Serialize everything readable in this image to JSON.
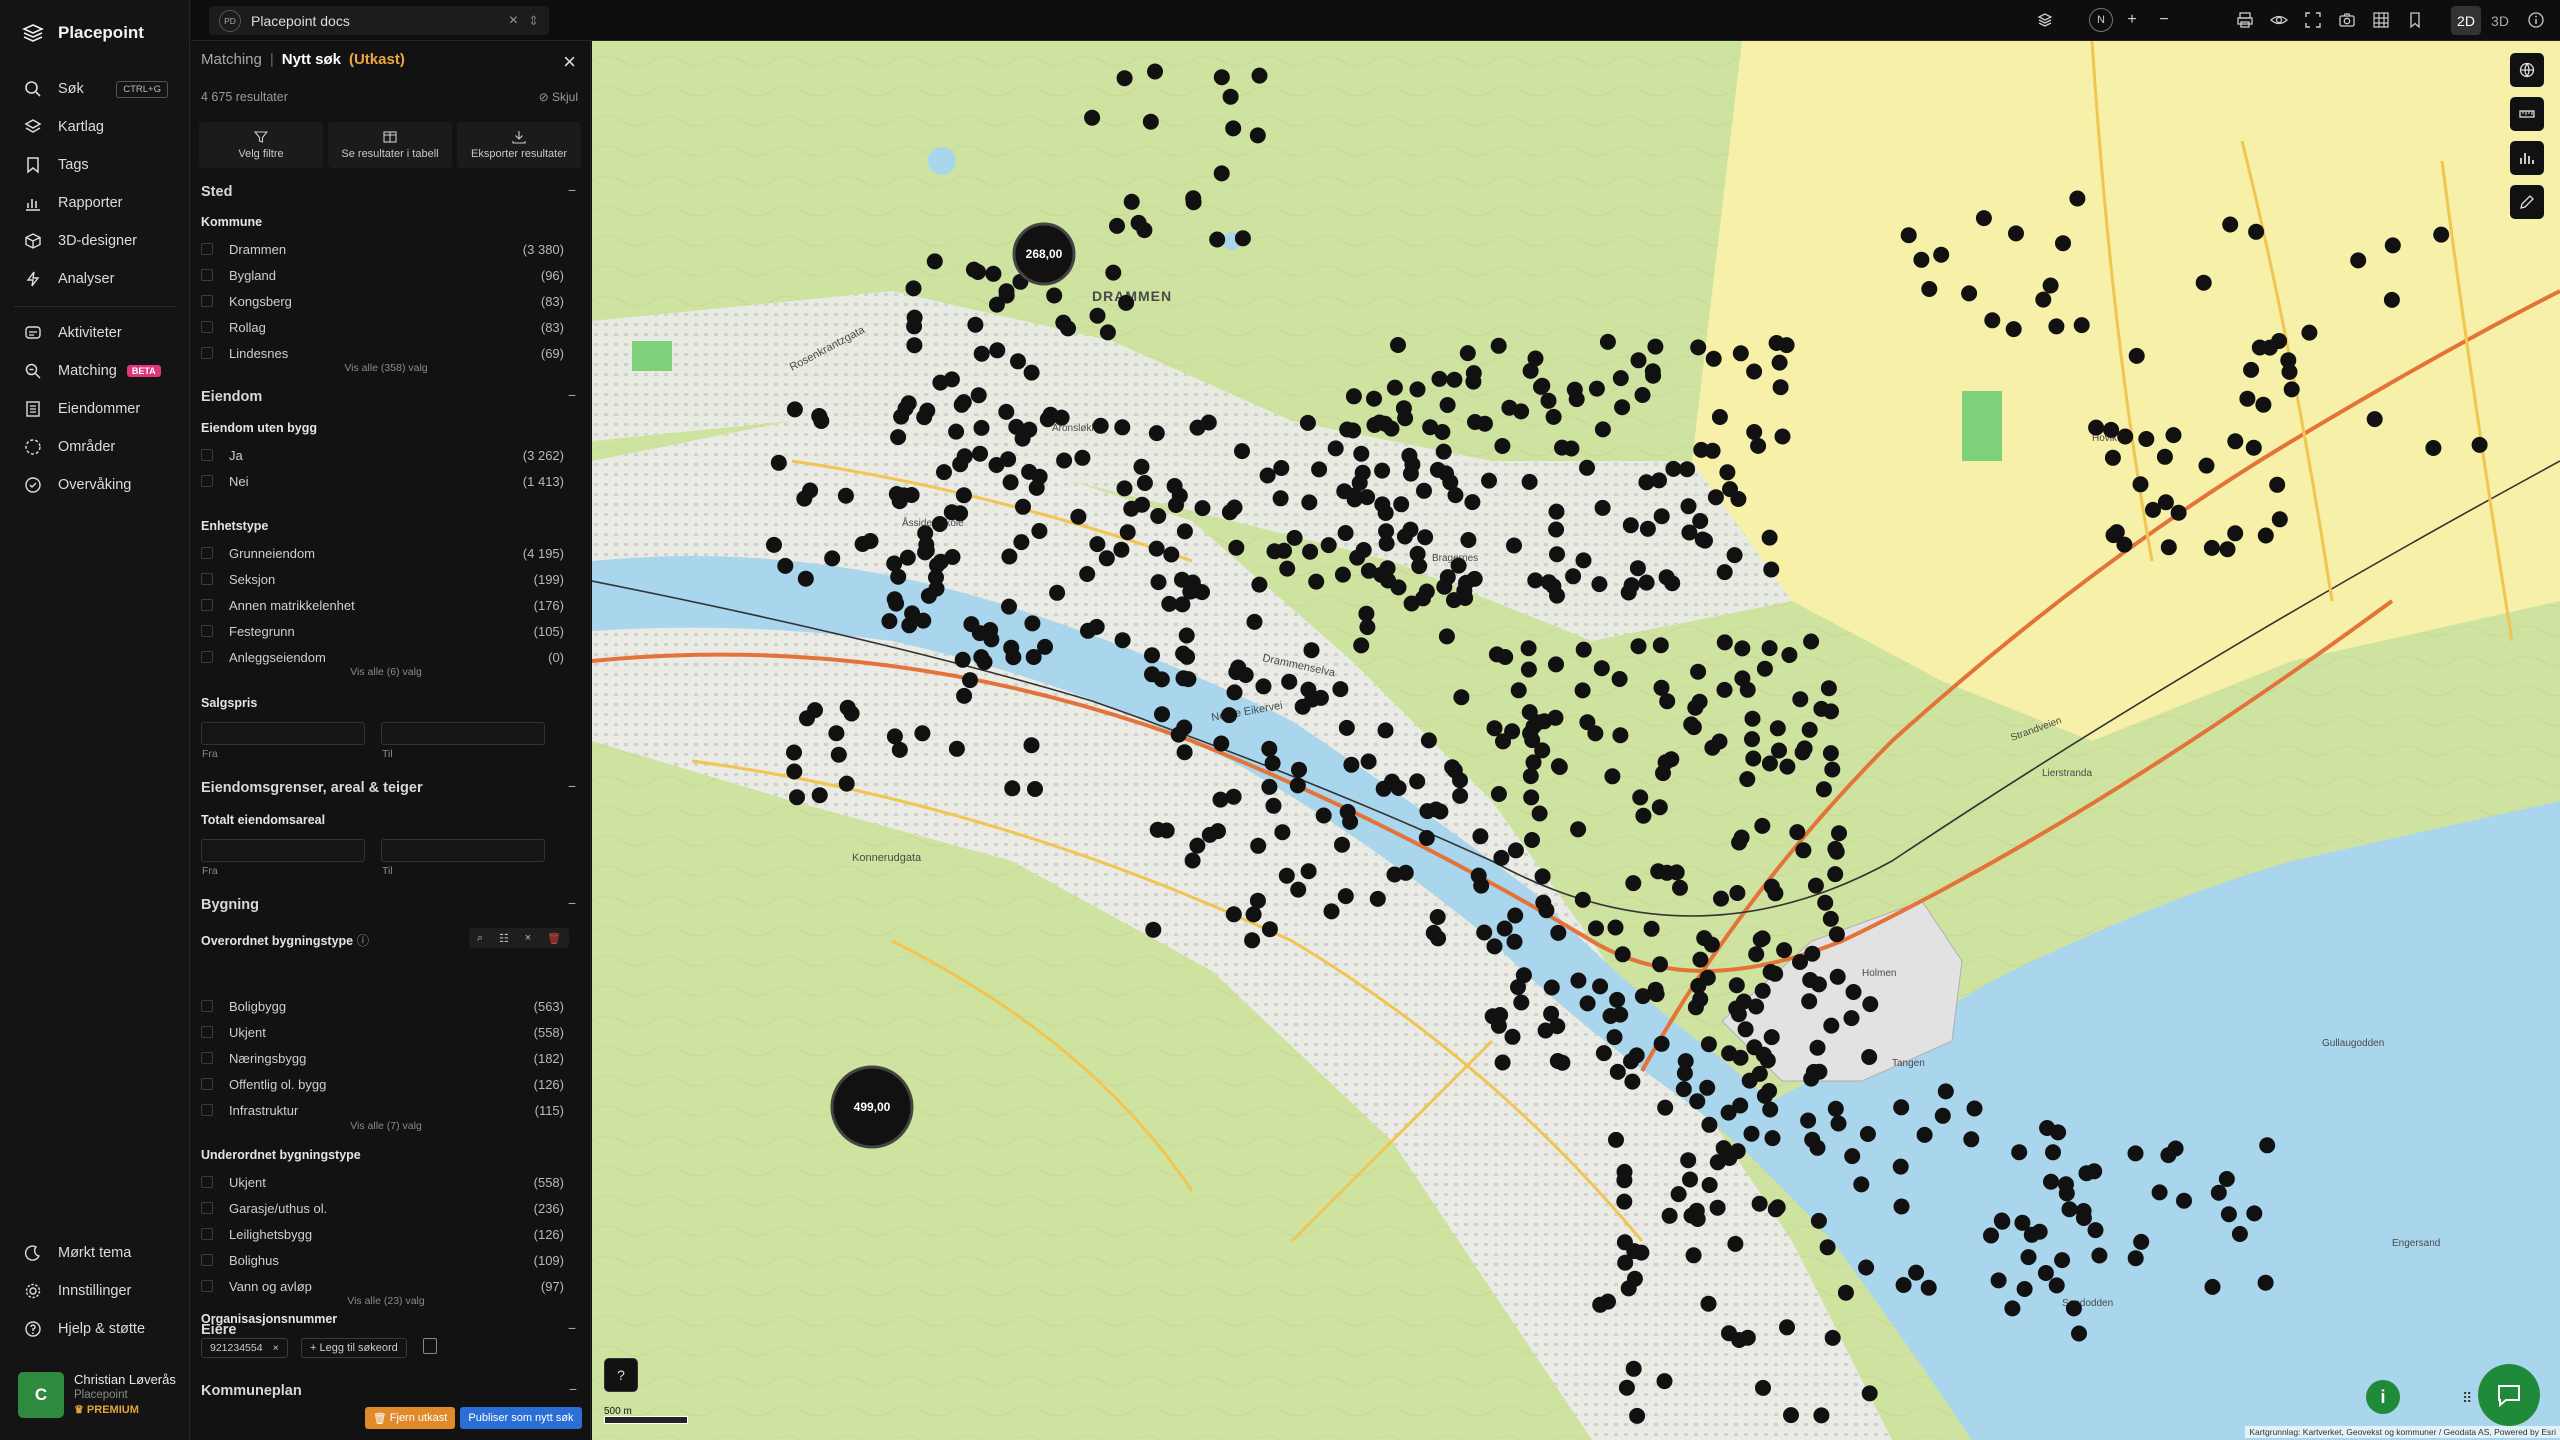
{
  "app": {
    "name": "Placepoint"
  },
  "nav": {
    "items": [
      {
        "label": "Søk",
        "shortcut": "CTRL+G",
        "icon": "search-icon"
      },
      {
        "label": "Kartlag",
        "icon": "layers-icon"
      },
      {
        "label": "Tags",
        "icon": "bookmark-icon"
      },
      {
        "label": "Rapporter",
        "icon": "chart-icon"
      },
      {
        "label": "3D-designer",
        "icon": "cube-icon"
      },
      {
        "label": "Analyser",
        "icon": "bolt-icon"
      },
      {
        "label": "Aktiviteter",
        "icon": "activity-icon"
      },
      {
        "label": "Matching",
        "badge": "BETA",
        "icon": "match-icon"
      },
      {
        "label": "Eiendommer",
        "icon": "building-icon"
      },
      {
        "label": "Områder",
        "icon": "area-icon"
      },
      {
        "label": "Overvåking",
        "icon": "monitor-icon"
      }
    ],
    "bottom": [
      {
        "label": "Mørkt tema",
        "icon": "moon-icon"
      },
      {
        "label": "Innstillinger",
        "icon": "gear-icon"
      },
      {
        "label": "Hjelp & støtte",
        "icon": "help-icon"
      }
    ],
    "user": {
      "initial": "C",
      "name": "Christian Løverås",
      "org": "Placepoint",
      "plan": "PREMIUM"
    }
  },
  "topbar": {
    "doc_badge": "PD",
    "doc_title": "Placepoint docs",
    "dim_2d": "2D",
    "dim_3d": "3D",
    "compass": "N"
  },
  "panel": {
    "crumb": "Matching",
    "separator": "|",
    "title": "Nytt søk",
    "status": "(Utkast)",
    "results": "4 675 resultater",
    "hide": "Skjul",
    "actions": [
      "Velg filtre",
      "Se resultater i tabell",
      "Eksporter resultater"
    ],
    "sted": {
      "title": "Sted",
      "kommune_label": "Kommune",
      "rows": [
        {
          "name": "Drammen",
          "count": "(3 380)"
        },
        {
          "name": "Bygland",
          "count": "(96)"
        },
        {
          "name": "Kongsberg",
          "count": "(83)"
        },
        {
          "name": "Rollag",
          "count": "(83)"
        },
        {
          "name": "Lindesnes",
          "count": "(69)"
        }
      ],
      "more": "Vis alle (358) valg"
    },
    "eiendom": {
      "title": "Eiendom",
      "uten_bygg_label": "Eiendom uten bygg",
      "uten_bygg": [
        {
          "name": "Ja",
          "count": "(3 262)"
        },
        {
          "name": "Nei",
          "count": "(1 413)"
        }
      ],
      "enhetstype_label": "Enhetstype",
      "enhetstype": [
        {
          "name": "Grunneiendom",
          "count": "(4 195)"
        },
        {
          "name": "Seksjon",
          "count": "(199)"
        },
        {
          "name": "Annen matrikkelenhet",
          "count": "(176)"
        },
        {
          "name": "Festegrunn",
          "count": "(105)"
        },
        {
          "name": "Anleggseiendom",
          "count": "(0)"
        }
      ],
      "enhetstype_more": "Vis alle (6) valg",
      "salgspris_label": "Salgspris",
      "from": "Fra",
      "to": "Til"
    },
    "grenser": {
      "title": "Eiendomsgrenser, areal & teiger",
      "areal_label": "Totalt eiendomsareal",
      "from": "Fra",
      "to": "Til"
    },
    "bygning": {
      "title": "Bygning",
      "overordnet_label": "Overordnet bygningstype",
      "overordnet": [
        {
          "name": "Boligbygg",
          "count": "(563)"
        },
        {
          "name": "Ukjent",
          "count": "(558)"
        },
        {
          "name": "Næringsbygg",
          "count": "(182)"
        },
        {
          "name": "Offentlig ol. bygg",
          "count": "(126)"
        },
        {
          "name": "Infrastruktur",
          "count": "(115)"
        }
      ],
      "overordnet_more": "Vis alle (7) valg",
      "underordnet_label": "Underordnet bygningstype",
      "underordnet": [
        {
          "name": "Ukjent",
          "count": "(558)"
        },
        {
          "name": "Garasje/uthus ol.",
          "count": "(236)"
        },
        {
          "name": "Leilighetsbygg",
          "count": "(126)"
        },
        {
          "name": "Bolighus",
          "count": "(109)"
        },
        {
          "name": "Vann og avløp",
          "count": "(97)"
        }
      ],
      "underordnet_more": "Vis alle (23) valg"
    },
    "eiere": {
      "title": "Eiere",
      "org_label": "Organisasjonsnummer",
      "chip": "921234554",
      "add": "Legg til søkeord"
    },
    "kommuneplan": {
      "title": "Kommuneplan"
    },
    "footer": {
      "remove": "Fjern utkast",
      "publish": "Publiser som nytt søk"
    }
  },
  "map": {
    "clusters": [
      {
        "label": "268,00"
      },
      {
        "label": "499,00"
      }
    ],
    "places": [
      "DRAMMEN",
      "Konnerudgata",
      "Rosenkrantzgata",
      "Drammenselva",
      "Nedre Eikervei",
      "Åssiden skole",
      "Holmen",
      "Gullaugodden",
      "Strandveien",
      "Lierstranda",
      "Hovik",
      "Tangen",
      "Engersand",
      "Sandodden",
      "Bragernes",
      "Aronsløkka"
    ],
    "scale": "500 m",
    "attribution": "Kartgrunnlag: Kartverket, Geovekst og kommuner / Geodata AS, Powered by Esri",
    "help": "?",
    "info": "i"
  },
  "colors": {
    "accent_orange": "#f0a640",
    "publish_blue": "#2b6fd6",
    "remove_orange": "#e08a2c",
    "beta_pink": "#e0357c",
    "brand_green": "#1f8a3a"
  }
}
